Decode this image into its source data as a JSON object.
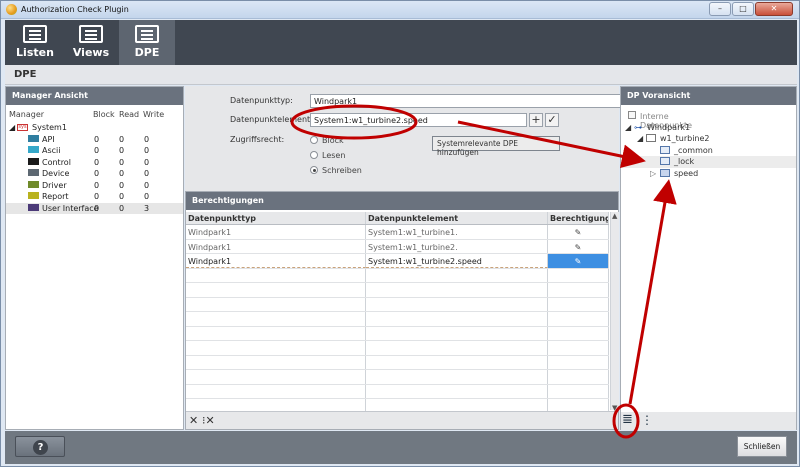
{
  "window": {
    "title": "Authorization Check Plugin",
    "minimize": "–",
    "maximize": "□",
    "close": "✕"
  },
  "toolbar": {
    "items": [
      {
        "label": "Listen"
      },
      {
        "label": "Views"
      },
      {
        "label": "DPE",
        "active": true
      }
    ]
  },
  "page": {
    "title": "DPE"
  },
  "manager": {
    "title": "Manager Ansicht",
    "columns": [
      "Manager",
      "Block",
      "Read",
      "Write"
    ],
    "root": "System1",
    "rows": [
      {
        "name": "API",
        "block": "0",
        "read": "0",
        "write": "0",
        "color": "#2f7ea0"
      },
      {
        "name": "Ascii",
        "block": "0",
        "read": "0",
        "write": "0",
        "color": "#35a8c9"
      },
      {
        "name": "Control",
        "block": "0",
        "read": "0",
        "write": "0",
        "color": "#1a1a1a"
      },
      {
        "name": "Device",
        "block": "0",
        "read": "0",
        "write": "0",
        "color": "#5d6872"
      },
      {
        "name": "Driver",
        "block": "0",
        "read": "0",
        "write": "0",
        "color": "#6f8a2a"
      },
      {
        "name": "Report",
        "block": "0",
        "read": "0",
        "write": "0",
        "color": "#b9b21e"
      },
      {
        "name": "User Interface",
        "block": "0",
        "read": "0",
        "write": "3",
        "color": "#4b3a78"
      }
    ]
  },
  "form": {
    "type_label": "Datenpunkttyp:",
    "type_value": "Windpark1",
    "element_label": "Datenpunktelement:",
    "element_value": "System1:w1_turbine2.speed",
    "add_icon": "+",
    "confirm_icon": "✓",
    "access_label": "Zugriffsrecht:",
    "radio_block": "Block",
    "radio_read": "Lesen",
    "radio_write": "Schreiben",
    "tooltip": "Systemrelevante DPE hinzufügen"
  },
  "permissions": {
    "title": "Berechtigungen",
    "columns": [
      "Datenpunkttyp",
      "Datenpunktelement",
      "Berechtigung"
    ],
    "rows": [
      {
        "type": "Windpark1",
        "element": "System1:w1_turbine1.",
        "perm": "✎"
      },
      {
        "type": "Windpark1",
        "element": "System1:w1_turbine2.",
        "perm": "✎"
      },
      {
        "type": "Windpark1",
        "element": "System1:w1_turbine2.speed",
        "perm": "✎"
      }
    ],
    "delete_icon": "✕",
    "delete_all_icon": "⁝✕"
  },
  "preview": {
    "title": "DP Voransicht",
    "internal_label": "Interne Datenpunkte",
    "tree": {
      "root": "Windpark1",
      "child": "w1_turbine2",
      "leaves": [
        "_common",
        "_lock",
        "speed"
      ]
    },
    "list_icon": "≣",
    "tree_icon": "⋮"
  },
  "footer": {
    "help": "?",
    "close": "Schließen"
  }
}
